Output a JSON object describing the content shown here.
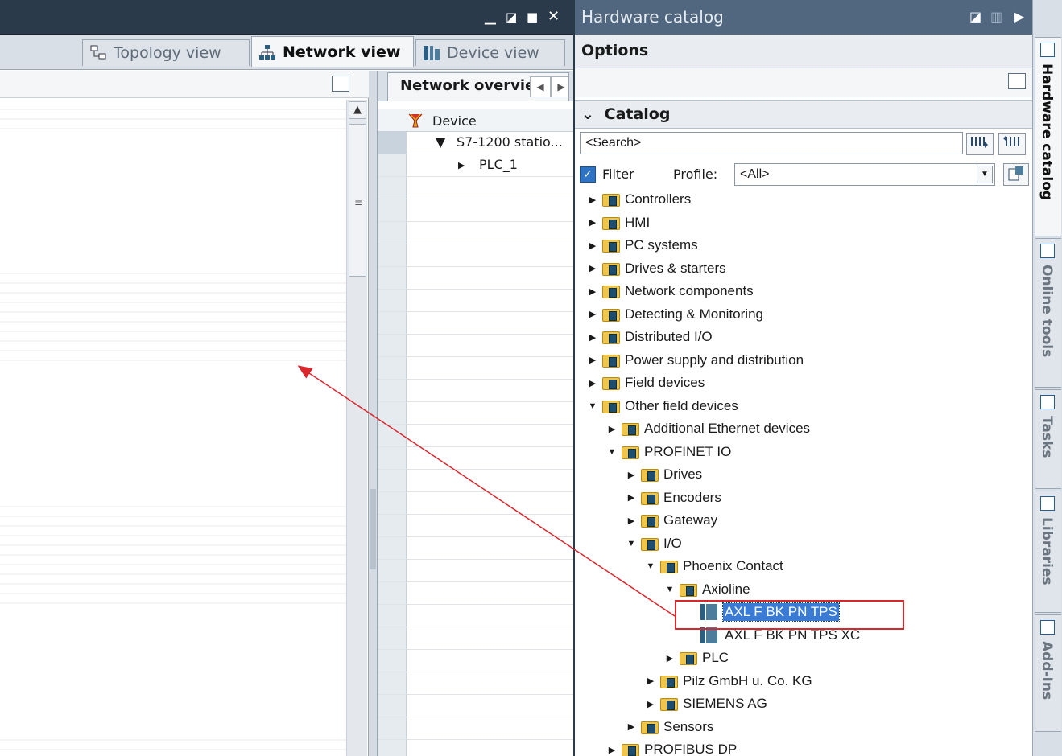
{
  "editor": {
    "tabs": [
      {
        "label": "Topology view"
      },
      {
        "label": "Network view"
      },
      {
        "label": "Device view"
      }
    ],
    "overview": {
      "tab_label": "Network overview",
      "column_header": "Device",
      "rows": [
        {
          "label": "S7-1200 statio..."
        },
        {
          "label": "PLC_1"
        }
      ]
    }
  },
  "catalog": {
    "title": "Hardware catalog",
    "options_label": "Options",
    "section_label": "Catalog",
    "search": {
      "value": "<Search>"
    },
    "filter_label": "Filter",
    "filter_checked": true,
    "profile_label": "Profile:",
    "profile_value": "<All>",
    "tree": [
      {
        "label": "Controllers",
        "expanded": false
      },
      {
        "label": "HMI",
        "expanded": false
      },
      {
        "label": "PC systems",
        "expanded": false
      },
      {
        "label": "Drives & starters",
        "expanded": false
      },
      {
        "label": "Network components",
        "expanded": false
      },
      {
        "label": "Detecting & Monitoring",
        "expanded": false
      },
      {
        "label": "Distributed I/O",
        "expanded": false
      },
      {
        "label": "Power supply and distribution",
        "expanded": false
      },
      {
        "label": "Field devices",
        "expanded": false
      },
      {
        "label": "Other field devices",
        "expanded": true
      },
      {
        "label": "Additional Ethernet devices",
        "expanded": false
      },
      {
        "label": "PROFINET IO",
        "expanded": true
      },
      {
        "label": "Drives",
        "expanded": false
      },
      {
        "label": "Encoders",
        "expanded": false
      },
      {
        "label": "Gateway",
        "expanded": false
      },
      {
        "label": "I/O",
        "expanded": true
      },
      {
        "label": "Phoenix Contact",
        "expanded": true
      },
      {
        "label": "Axioline",
        "expanded": true
      },
      {
        "label": "AXL F BK PN TPS",
        "selected": true
      },
      {
        "label": "AXL F BK PN TPS XC",
        "selected": false
      },
      {
        "label": "PLC",
        "expanded": false
      },
      {
        "label": "Pilz GmbH u. Co. KG",
        "expanded": false
      },
      {
        "label": "SIEMENS AG",
        "expanded": false
      },
      {
        "label": "Sensors",
        "expanded": false
      },
      {
        "label": "PROFIBUS DP",
        "expanded": false
      }
    ]
  },
  "side_tabs": [
    {
      "label": "Hardware catalog",
      "active": true
    },
    {
      "label": "Online tools",
      "active": false
    },
    {
      "label": "Tasks",
      "active": false
    },
    {
      "label": "Libraries",
      "active": false
    },
    {
      "label": "Add-Ins",
      "active": false
    }
  ],
  "colors": {
    "accent": "#3a7bd5",
    "title_bar_dark": "#2b3a4a",
    "catalog_title": "#50677f",
    "annotation_red": "#d9272e",
    "folder_yellow": "#f0c64a"
  }
}
